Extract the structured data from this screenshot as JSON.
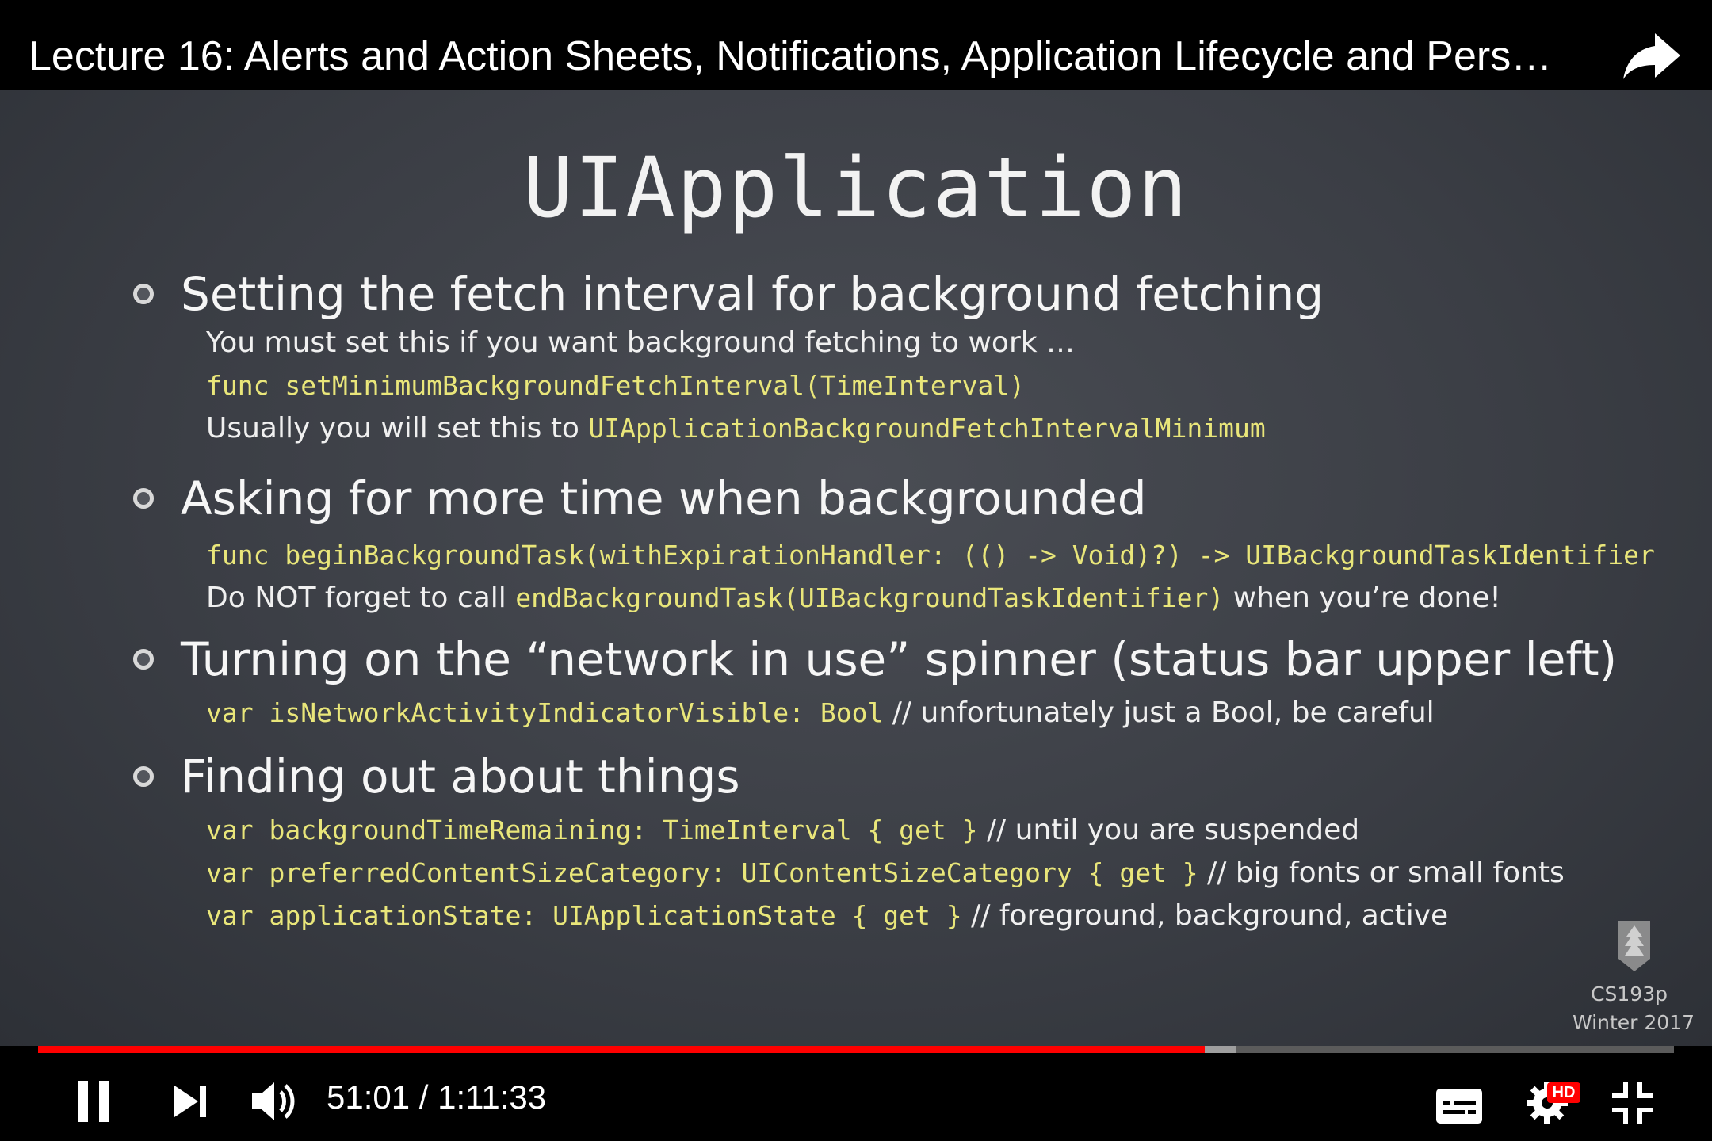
{
  "header": {
    "title": "Lecture 16: Alerts and Action Sheets, Notifications, Application Lifecycle and Pers…",
    "share_icon": "share-arrow-icon"
  },
  "slide": {
    "title": "UIApplication",
    "bullets": [
      {
        "heading": "Setting the fetch interval for background fetching",
        "lines": [
          {
            "text": "You must set this if you want background fetching to work …"
          },
          {
            "code": "func setMinimumBackgroundFetchInterval(TimeInterval)"
          },
          {
            "text": "Usually you will set this to ",
            "code": "UIApplicationBackgroundFetchIntervalMinimum"
          }
        ]
      },
      {
        "heading": "Asking for more time when backgrounded",
        "lines": [
          {
            "code": "func beginBackgroundTask(withExpirationHandler: (() -> Void)?) -> UIBackgroundTaskIdentifier"
          },
          {
            "text": "Do NOT forget to call ",
            "code": "endBackgroundTask(UIBackgroundTaskIdentifier)",
            "text2": " when you’re done!"
          }
        ]
      },
      {
        "heading": "Turning on the “network in use” spinner (status bar upper left)",
        "lines": [
          {
            "code": "var isNetworkActivityIndicatorVisible: Bool",
            "text2": " // unfortunately just a Bool, be careful"
          }
        ]
      },
      {
        "heading": "Finding out about things",
        "lines": [
          {
            "code": "var backgroundTimeRemaining: TimeInterval { get }",
            "text2": " // until you are suspended"
          },
          {
            "code": "var preferredContentSizeCategory: UIContentSizeCategory { get }",
            "text2": " // big fonts or small fonts"
          },
          {
            "code": "var applicationState: UIApplicationState { get }",
            "text2": " // foreground, background, active"
          }
        ]
      }
    ],
    "course": "CS193p",
    "term": "Winter 2017"
  },
  "player": {
    "current_time": "51:01",
    "separator": " / ",
    "duration": "1:11:33",
    "played_fraction": 0.713,
    "buffered_fraction": 0.732,
    "hd_badge": "HD",
    "colors": {
      "played": "#ff0000",
      "buffered": "#9e9e9e",
      "track": "#5b5b5b",
      "code": "#e9e67a"
    }
  }
}
